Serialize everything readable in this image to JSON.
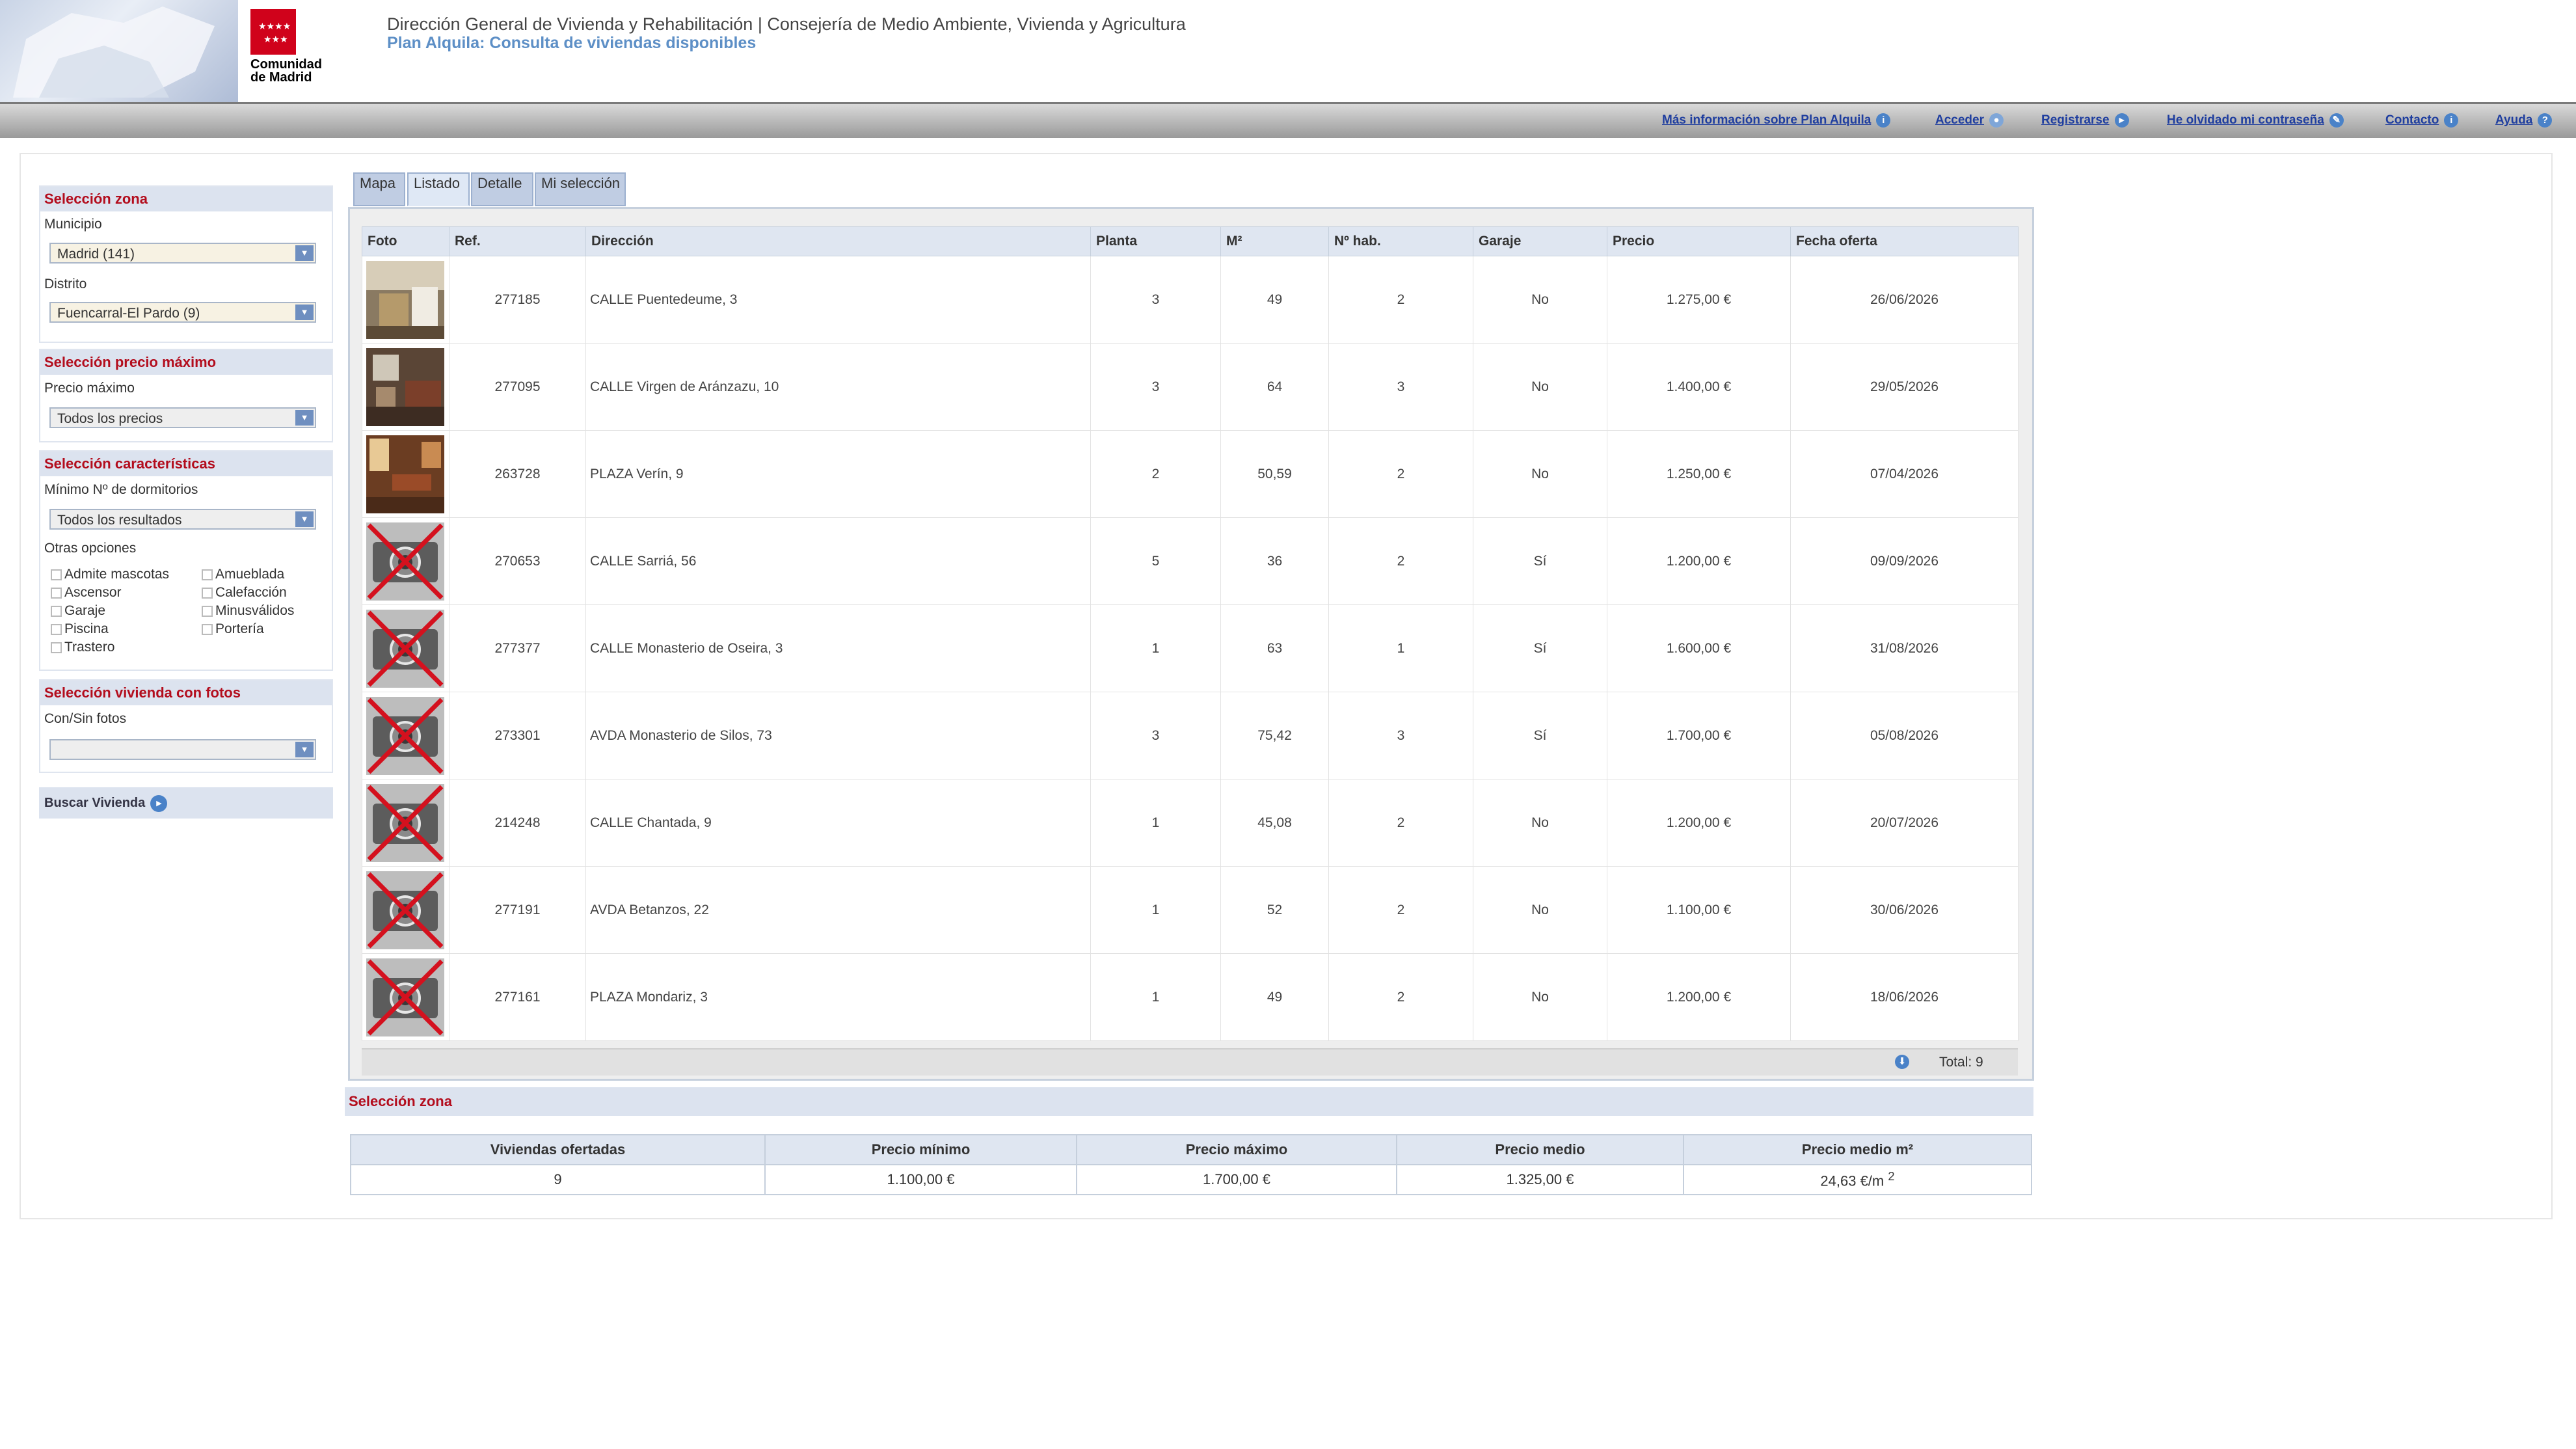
{
  "header": {
    "logo_text_line1": "Comunidad",
    "logo_text_line2": "de Madrid",
    "title": "Dirección General de Vivienda y Rehabilitación | Consejería de Medio Ambiente, Vivienda y Agricultura",
    "subtitle": "Plan Alquila: Consulta de viviendas disponibles"
  },
  "nav": {
    "info": "Más información sobre Plan Alquila",
    "login": "Acceder",
    "register": "Registrarse",
    "forgot": "He olvidado mi contraseña",
    "contact": "Contacto",
    "help": "Ayuda"
  },
  "sidebar": {
    "zona": {
      "title": "Selección zona",
      "municipio_label": "Municipio",
      "municipio_value": "Madrid (141)",
      "distrito_label": "Distrito",
      "distrito_value": "Fuencarral-El Pardo (9)"
    },
    "precio": {
      "title": "Selección precio máximo",
      "label": "Precio máximo",
      "value": "Todos los precios"
    },
    "caracteristicas": {
      "title": "Selección características",
      "dorm_label": "Mínimo Nº de dormitorios",
      "dorm_value": "Todos los resultados",
      "otras_label": "Otras opciones",
      "options": [
        "Admite mascotas",
        "Amueblada",
        "Ascensor",
        "Calefacción",
        "Garaje",
        "Minusválidos",
        "Piscina",
        "Portería",
        "Trastero"
      ]
    },
    "fotos": {
      "title": "Selección vivienda con fotos",
      "label": "Con/Sin fotos",
      "value": ""
    },
    "search_button": "Buscar Vivienda"
  },
  "tabs": [
    "Mapa",
    "Listado",
    "Detalle",
    "Mi selección"
  ],
  "listing": {
    "columns": [
      "Foto",
      "Ref.",
      "Dirección",
      "Planta",
      "M²",
      "Nº hab.",
      "Garaje",
      "Precio",
      "Fecha oferta"
    ],
    "rows": [
      {
        "photo": "interior-kitchen",
        "ref": "277185",
        "address": "CALLE Puentedeume, 3",
        "floor": "3",
        "m2": "49",
        "rooms": "2",
        "garage": "No",
        "price": "1.275,00 €",
        "date": "26/06/2026"
      },
      {
        "photo": "interior-living-room",
        "ref": "277095",
        "address": "CALLE Virgen de Aránzazu, 10",
        "floor": "3",
        "m2": "64",
        "rooms": "3",
        "garage": "No",
        "price": "1.400,00 €",
        "date": "29/05/2026"
      },
      {
        "photo": "interior-dining-room",
        "ref": "263728",
        "address": "PLAZA Verín, 9",
        "floor": "2",
        "m2": "50,59",
        "rooms": "2",
        "garage": "No",
        "price": "1.250,00 €",
        "date": "07/04/2026"
      },
      {
        "photo": "no-photo",
        "ref": "270653",
        "address": "CALLE Sarriá, 56",
        "floor": "5",
        "m2": "36",
        "rooms": "2",
        "garage": "Sí",
        "price": "1.200,00 €",
        "date": "09/09/2026"
      },
      {
        "photo": "no-photo",
        "ref": "277377",
        "address": "CALLE Monasterio de Oseira, 3",
        "floor": "1",
        "m2": "63",
        "rooms": "1",
        "garage": "Sí",
        "price": "1.600,00 €",
        "date": "31/08/2026"
      },
      {
        "photo": "no-photo",
        "ref": "273301",
        "address": "AVDA Monasterio de Silos, 73",
        "floor": "3",
        "m2": "75,42",
        "rooms": "3",
        "garage": "Sí",
        "price": "1.700,00 €",
        "date": "05/08/2026"
      },
      {
        "photo": "no-photo",
        "ref": "214248",
        "address": "CALLE Chantada, 9",
        "floor": "1",
        "m2": "45,08",
        "rooms": "2",
        "garage": "No",
        "price": "1.200,00 €",
        "date": "20/07/2026"
      },
      {
        "photo": "no-photo",
        "ref": "277191",
        "address": "AVDA Betanzos, 22",
        "floor": "1",
        "m2": "52",
        "rooms": "2",
        "garage": "No",
        "price": "1.100,00 €",
        "date": "30/06/2026"
      },
      {
        "photo": "no-photo",
        "ref": "277161",
        "address": "PLAZA Mondariz, 3",
        "floor": "1",
        "m2": "49",
        "rooms": "2",
        "garage": "No",
        "price": "1.200,00 €",
        "date": "18/06/2026"
      }
    ],
    "total": "Total: 9"
  },
  "summary": {
    "title": "Selección zona",
    "columns": [
      "Viviendas ofertadas",
      "Precio mínimo",
      "Precio máximo",
      "Precio medio",
      "Precio medio m²"
    ],
    "values": [
      "9",
      "1.100,00 €",
      "1.700,00 €",
      "1.325,00 €",
      "24,63 €/m"
    ],
    "last_superscript": "2"
  },
  "colors": {
    "accent_red": "#b30d1d",
    "header_blue": "#dce3ef",
    "link_blue": "#1f3e9f"
  }
}
